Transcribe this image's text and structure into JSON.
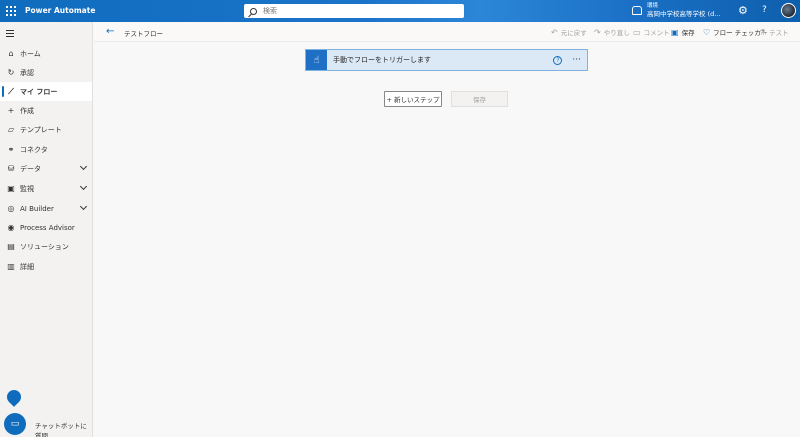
{
  "header": {
    "app_title": "Power Automate",
    "search_placeholder": "検索",
    "environment_label": "環境",
    "environment_name": "高岡中学校高等学校 (d...",
    "help": "?"
  },
  "sidebar": {
    "items": [
      {
        "label": "ホーム",
        "icon": "home-icon"
      },
      {
        "label": "承認",
        "icon": "approvals-icon"
      },
      {
        "label": "マイ フロー",
        "icon": "flow-icon",
        "active": true
      },
      {
        "label": "作成",
        "icon": "plus-icon"
      },
      {
        "label": "テンプレート",
        "icon": "template-icon"
      },
      {
        "label": "コネクタ",
        "icon": "connector-icon"
      },
      {
        "label": "データ",
        "icon": "database-icon",
        "expandable": true
      },
      {
        "label": "監視",
        "icon": "monitor-icon",
        "expandable": true
      },
      {
        "label": "AI Builder",
        "icon": "ai-builder-icon",
        "expandable": true
      },
      {
        "label": "Process Advisor",
        "icon": "process-advisor-icon"
      },
      {
        "label": "ソリューション",
        "icon": "solutions-icon"
      },
      {
        "label": "詳細",
        "icon": "learn-icon"
      }
    ],
    "chatbot_label": "チャットボットに質問"
  },
  "commandbar": {
    "flow_name": "テストフロー",
    "undo": "元に戻す",
    "redo": "やり直し",
    "comment": "コメント",
    "save": "保存",
    "flow_checker": "フロー チェッカー",
    "test": "テスト"
  },
  "canvas": {
    "trigger_title": "手動でフローをトリガーします",
    "new_step_label": "+ 新しいステップ",
    "save_label": "保存"
  },
  "colors": {
    "accent": "#0f6cbd",
    "trigger_bg": "#dbe9f7"
  }
}
